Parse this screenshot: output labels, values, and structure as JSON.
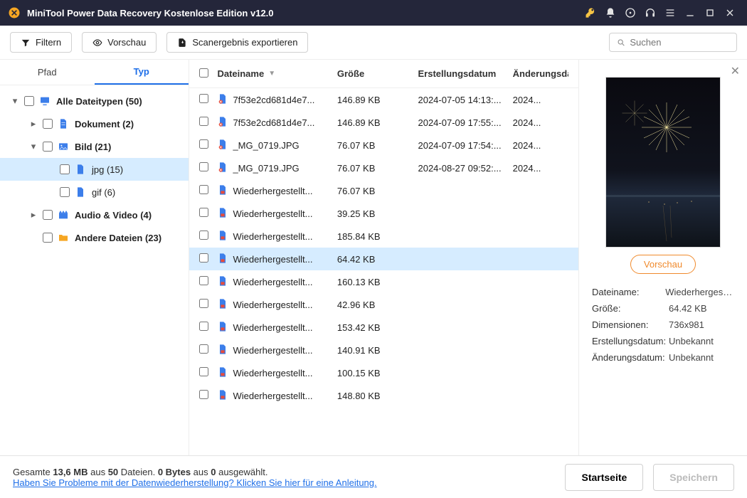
{
  "window": {
    "title": "MiniTool Power Data Recovery Kostenlose Edition v12.0"
  },
  "toolbar": {
    "filter_label": "Filtern",
    "preview_label": "Vorschau",
    "export_label": "Scanergebnis exportieren",
    "search_placeholder": "Suchen"
  },
  "tabs": {
    "path": "Pfad",
    "type": "Typ"
  },
  "tree": {
    "all": "Alle Dateitypen (50)",
    "doc": "Dokument (2)",
    "image": "Bild (21)",
    "jpg": "jpg (15)",
    "gif": "gif (6)",
    "av": "Audio & Video (4)",
    "other": "Andere Dateien (23)"
  },
  "columns": {
    "name": "Dateiname",
    "size": "Größe",
    "created": "Erstellungsdatum",
    "modified": "Änderungsdatum"
  },
  "files": [
    {
      "name": "7f53e2cd681d4e7...",
      "size": "146.89 KB",
      "created": "2024-07-05 14:13:...",
      "modified": "2024...",
      "deleted": true
    },
    {
      "name": "7f53e2cd681d4e7...",
      "size": "146.89 KB",
      "created": "2024-07-09 17:55:...",
      "modified": "2024...",
      "deleted": true
    },
    {
      "name": "_MG_0719.JPG",
      "size": "76.07 KB",
      "created": "2024-07-09 17:54:...",
      "modified": "2024...",
      "deleted": true
    },
    {
      "name": "_MG_0719.JPG",
      "size": "76.07 KB",
      "created": "2024-08-27 09:52:...",
      "modified": "2024...",
      "deleted": true
    },
    {
      "name": "Wiederhergestellt...",
      "size": "76.07 KB",
      "created": "",
      "modified": "",
      "deleted": false
    },
    {
      "name": "Wiederhergestellt...",
      "size": "39.25 KB",
      "created": "",
      "modified": "",
      "deleted": false
    },
    {
      "name": "Wiederhergestellt...",
      "size": "185.84 KB",
      "created": "",
      "modified": "",
      "deleted": false
    },
    {
      "name": "Wiederhergestellt...",
      "size": "64.42 KB",
      "created": "",
      "modified": "",
      "deleted": false,
      "selected": true
    },
    {
      "name": "Wiederhergestellt...",
      "size": "160.13 KB",
      "created": "",
      "modified": "",
      "deleted": false
    },
    {
      "name": "Wiederhergestellt...",
      "size": "42.96 KB",
      "created": "",
      "modified": "",
      "deleted": false
    },
    {
      "name": "Wiederhergestellt...",
      "size": "153.42 KB",
      "created": "",
      "modified": "",
      "deleted": false
    },
    {
      "name": "Wiederhergestellt...",
      "size": "140.91 KB",
      "created": "",
      "modified": "",
      "deleted": false
    },
    {
      "name": "Wiederhergestellt...",
      "size": "100.15 KB",
      "created": "",
      "modified": "",
      "deleted": false
    },
    {
      "name": "Wiederhergestellt...",
      "size": "148.80 KB",
      "created": "",
      "modified": "",
      "deleted": false
    }
  ],
  "preview": {
    "button": "Vorschau",
    "fields": {
      "filename_k": "Dateiname:",
      "filename_v": "Wiederhergestellt",
      "size_k": "Größe:",
      "size_v": "64.42 KB",
      "dim_k": "Dimensionen:",
      "dim_v": "736x981",
      "created_k": "Erstellungsdatum:",
      "created_v": "Unbekannt",
      "modified_k": "Änderungsdatum:",
      "modified_v": "Unbekannt"
    }
  },
  "footer": {
    "total_prefix": "Gesamte ",
    "total_size": "13,6 MB",
    "total_mid": " aus ",
    "total_count": "50",
    "total_after": " Dateien.  ",
    "sel_size": "0 Bytes",
    "sel_mid": " aus ",
    "sel_count": "0",
    "sel_after": " ausgewählt.",
    "help_link": "Haben Sie Probleme mit der Datenwiederherstellung? Klicken Sie hier für eine Anleitung.",
    "home": "Startseite",
    "save": "Speichern"
  }
}
